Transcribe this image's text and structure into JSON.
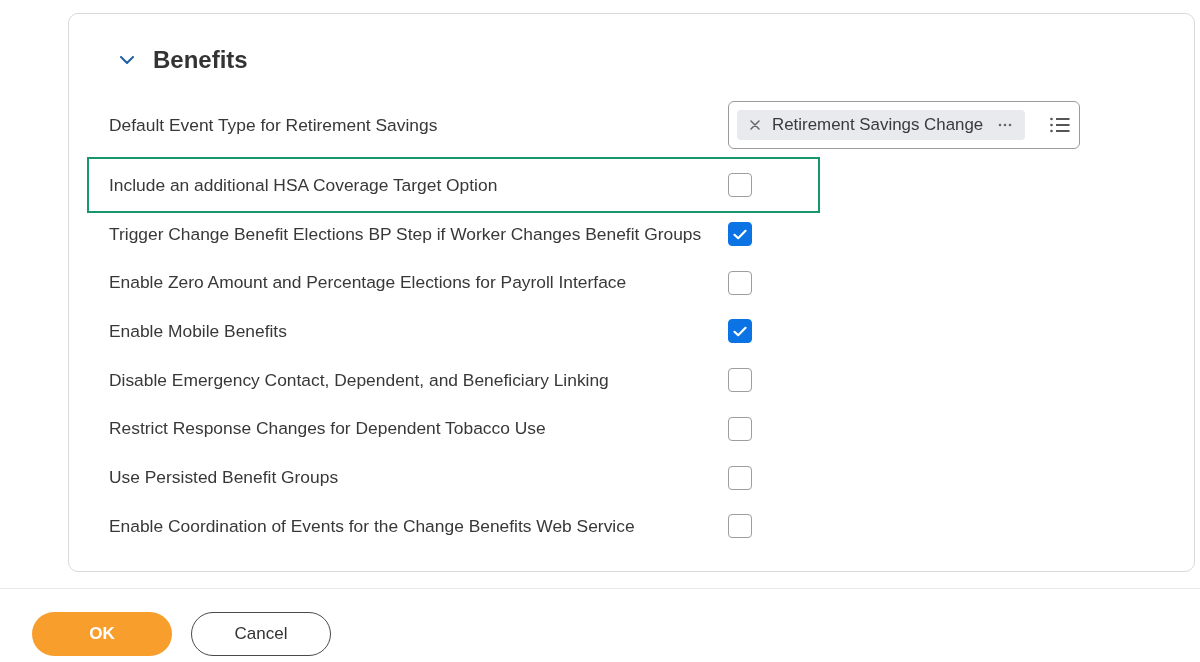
{
  "section": {
    "title": "Benefits",
    "expanded": true
  },
  "fields": [
    {
      "kind": "multiselect",
      "label": "Default Event Type for Retirement Savings",
      "highlighted": false,
      "selected_items": [
        "Retirement Savings Change"
      ]
    },
    {
      "kind": "checkbox",
      "label": "Include an additional HSA Coverage Target Option",
      "checked": false,
      "highlighted": true
    },
    {
      "kind": "checkbox",
      "label": "Trigger Change Benefit Elections BP Step if Worker Changes Benefit Groups",
      "checked": true,
      "highlighted": false
    },
    {
      "kind": "checkbox",
      "label": "Enable Zero Amount and Percentage Elections for Payroll Interface",
      "checked": false,
      "highlighted": false
    },
    {
      "kind": "checkbox",
      "label": "Enable Mobile Benefits",
      "checked": true,
      "highlighted": false
    },
    {
      "kind": "checkbox",
      "label": "Disable Emergency Contact, Dependent, and Beneficiary Linking",
      "checked": false,
      "highlighted": false
    },
    {
      "kind": "checkbox",
      "label": "Restrict Response Changes for Dependent Tobacco Use",
      "checked": false,
      "highlighted": false
    },
    {
      "kind": "checkbox",
      "label": "Use Persisted Benefit Groups",
      "checked": false,
      "highlighted": false
    },
    {
      "kind": "checkbox",
      "label": "Enable Coordination of Events for the Change Benefits Web Service",
      "checked": false,
      "highlighted": false
    }
  ],
  "buttons": [
    {
      "label": "OK",
      "kind": "primary"
    },
    {
      "label": "Cancel",
      "kind": "secondary"
    }
  ]
}
